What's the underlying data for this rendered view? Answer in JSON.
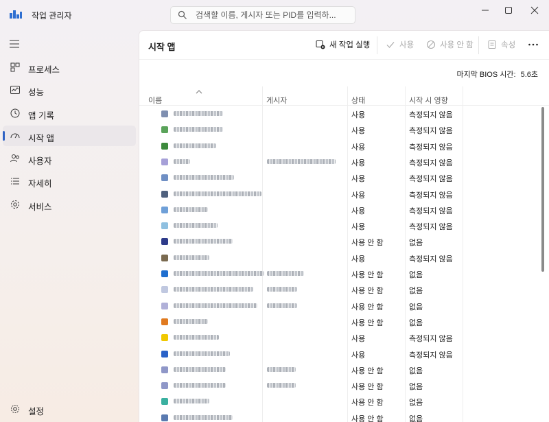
{
  "window": {
    "title": "작업 관리자",
    "search_placeholder": "검색할 이름, 게시자 또는 PID를 입력하..."
  },
  "sidebar": {
    "items": [
      {
        "label": "프로세스",
        "icon": "processes-icon"
      },
      {
        "label": "성능",
        "icon": "performance-icon"
      },
      {
        "label": "앱 기록",
        "icon": "history-icon"
      },
      {
        "label": "시작 앱",
        "icon": "startup-icon",
        "active": true
      },
      {
        "label": "사용자",
        "icon": "users-icon"
      },
      {
        "label": "자세히",
        "icon": "details-icon"
      },
      {
        "label": "서비스",
        "icon": "services-icon"
      }
    ],
    "settings_label": "설정"
  },
  "toolbar": {
    "title": "시작 앱",
    "run_new_task": "새 작업 실행",
    "enable": "사용",
    "disable": "사용 안 함",
    "properties": "속성"
  },
  "bios": {
    "label": "마지막 BIOS 시간:",
    "value": "5.6초"
  },
  "table": {
    "columns": [
      "이름",
      "게시자",
      "상태",
      "시작 시 영향"
    ],
    "rows": [
      {
        "status": "사용",
        "impact": "측정되지 않음",
        "icon_color": "#7f8fb0"
      },
      {
        "status": "사용",
        "impact": "측정되지 않음",
        "icon_color": "#5aa35a"
      },
      {
        "status": "사용",
        "impact": "측정되지 않음",
        "icon_color": "#3d8a3d"
      },
      {
        "status": "사용",
        "impact": "측정되지 않음",
        "icon_color": "#a6a0d8"
      },
      {
        "status": "사용",
        "impact": "측정되지 않음",
        "icon_color": "#6f8fc4"
      },
      {
        "status": "사용",
        "impact": "측정되지 않음",
        "icon_color": "#50617e"
      },
      {
        "status": "사용",
        "impact": "측정되지 않음",
        "icon_color": "#6fa0d8"
      },
      {
        "status": "사용",
        "impact": "측정되지 않음",
        "icon_color": "#8fc0e0"
      },
      {
        "status": "사용 안 함",
        "impact": "없음",
        "icon_color": "#2e3b8a"
      },
      {
        "status": "사용",
        "impact": "측정되지 않음",
        "icon_color": "#7a6a50"
      },
      {
        "status": "사용 안 함",
        "impact": "없음",
        "icon_color": "#1f6fcf"
      },
      {
        "status": "사용 안 함",
        "impact": "없음",
        "icon_color": "#c0c8e0"
      },
      {
        "status": "사용 안 함",
        "impact": "없음",
        "icon_color": "#b0b0d8"
      },
      {
        "status": "사용 안 함",
        "impact": "없음",
        "icon_color": "#e07a20"
      },
      {
        "status": "사용",
        "impact": "측정되지 않음",
        "icon_color": "#f0c800"
      },
      {
        "status": "사용",
        "impact": "측정되지 않음",
        "icon_color": "#2a62c8"
      },
      {
        "status": "사용 안 함",
        "impact": "없음",
        "icon_color": "#8f97c8"
      },
      {
        "status": "사용 안 함",
        "impact": "없음",
        "icon_color": "#8f97c8"
      },
      {
        "status": "사용 안 함",
        "impact": "없음",
        "icon_color": "#3ab0a0"
      },
      {
        "status": "사용 안 함",
        "impact": "없음",
        "icon_color": "#5a7ab0"
      }
    ]
  }
}
